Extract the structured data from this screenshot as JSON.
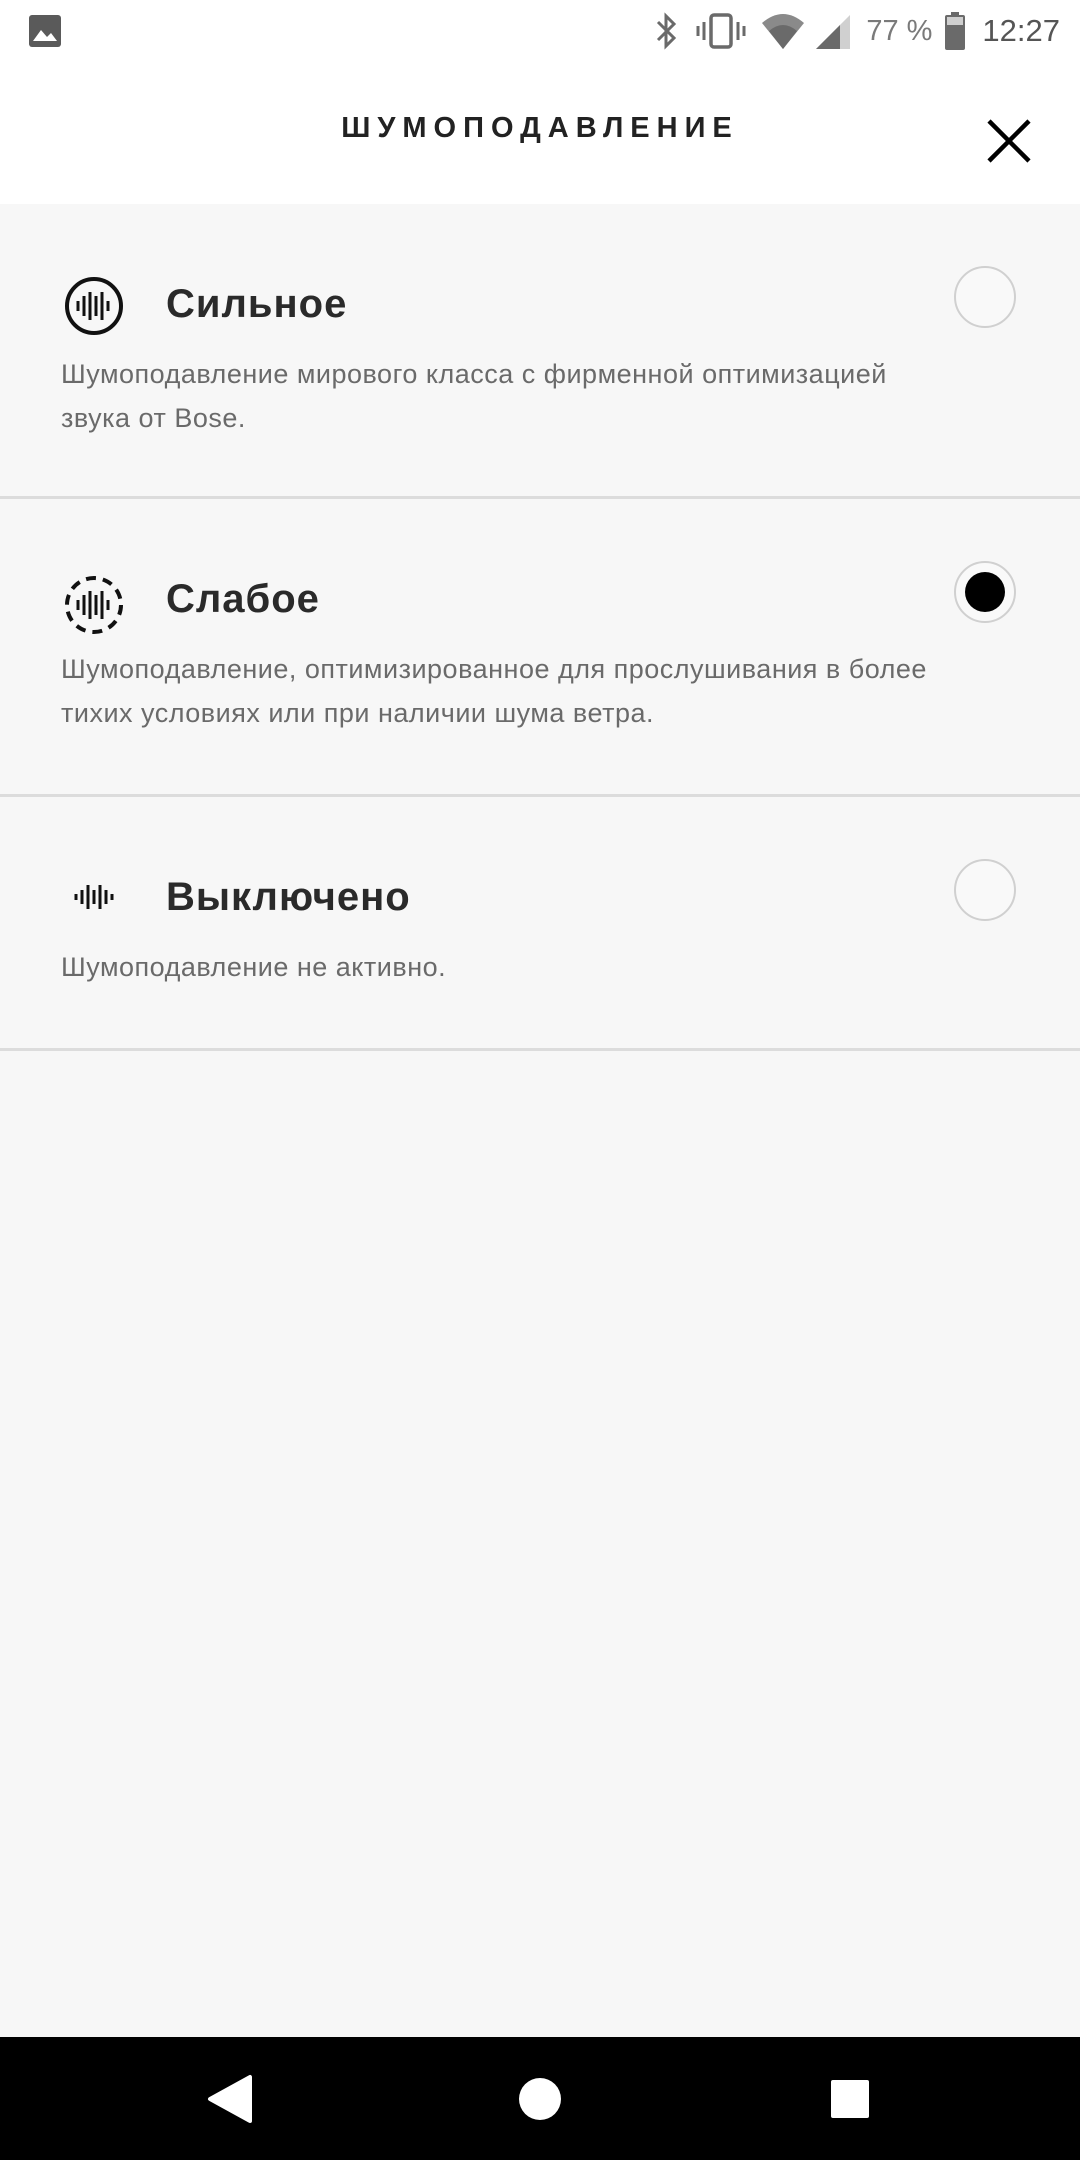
{
  "status_bar": {
    "battery": "77 %",
    "time": "12:27",
    "icons": [
      "gallery-icon",
      "bluetooth-icon",
      "vibrate-icon",
      "wifi-icon",
      "signal-icon",
      "battery-icon"
    ]
  },
  "header": {
    "title": "ШУМОПОДАВЛЕНИЕ",
    "close_icon": "close-icon"
  },
  "options": [
    {
      "title": "Сильное",
      "description": "Шумоподавление мирового класса с фирменной оптимизацией звука от Bose.",
      "icon": "noise-cancel-high-icon",
      "selected": false
    },
    {
      "title": "Слабое",
      "description": "Шумоподавление, оптимизированное для прослушивания в более тихих условиях или при наличии шума ветра.",
      "icon": "noise-cancel-low-icon",
      "selected": true
    },
    {
      "title": "Выключено",
      "description": "Шумоподавление не активно.",
      "icon": "noise-cancel-off-icon",
      "selected": false
    }
  ],
  "nav_bar": {
    "icons": [
      "back-icon",
      "home-icon",
      "recents-icon"
    ]
  },
  "colors": {
    "background": "#f7f7f7",
    "header": "#ffffff",
    "title_text": "#2a2a2a",
    "description_text": "#6a6a6a",
    "radio_selected": "#000000",
    "divider": "#dcdcdc"
  }
}
